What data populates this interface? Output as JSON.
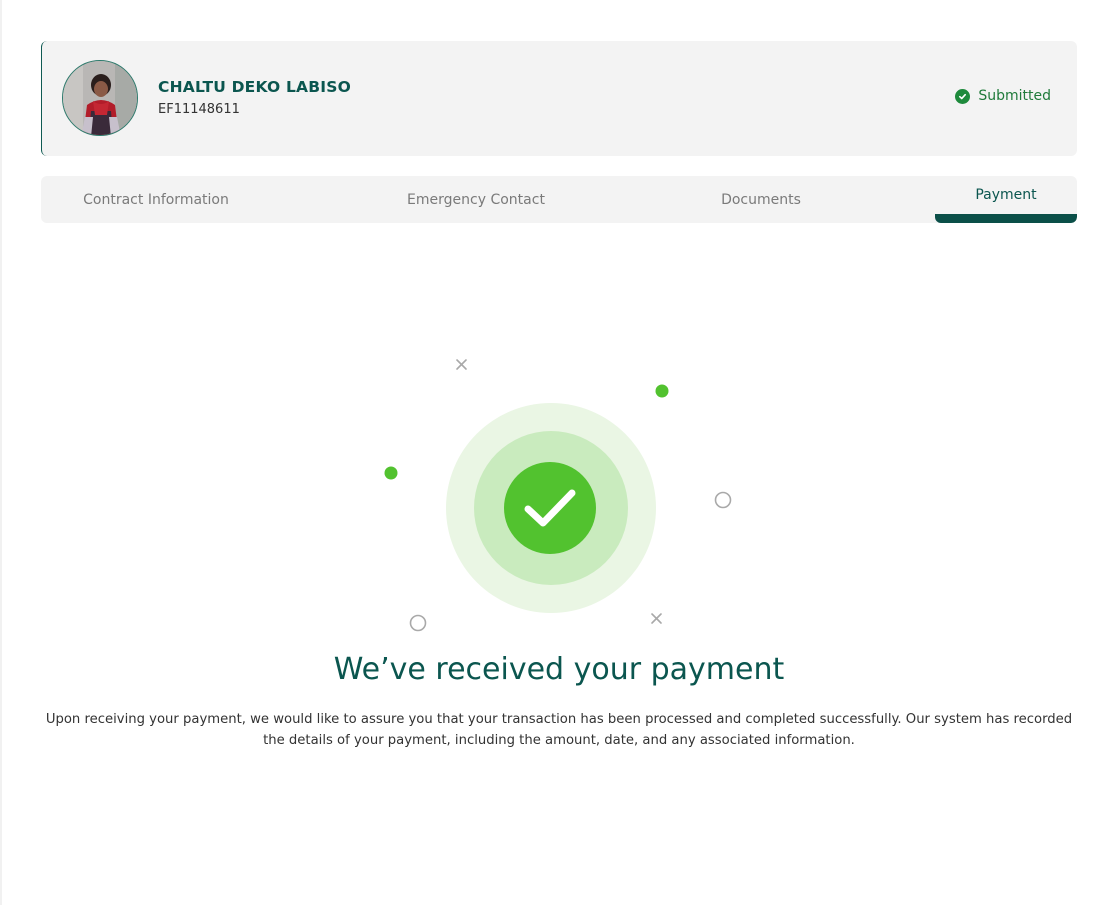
{
  "profile": {
    "name": "CHALTU DEKO LABISO",
    "id": "EF11148611",
    "status": "Submitted",
    "avatar_icon": "user-photo"
  },
  "tabs": [
    {
      "label": "Contract Information",
      "active": false
    },
    {
      "label": "Emergency Contact",
      "active": false
    },
    {
      "label": "Documents",
      "active": false
    },
    {
      "label": "Payment",
      "active": true
    }
  ],
  "confirmation": {
    "icon": "check-circle-icon",
    "title": "We’ve received your payment",
    "message": "Upon receiving your payment, we would like to assure you that your transaction has been processed and completed successfully. Our system has recorded the details of your payment, including the amount, date, and any associated information."
  },
  "colors": {
    "brand": "#0b564f",
    "success": "#52c22f",
    "status_green": "#1f7a3a",
    "panel_bg": "#f3f3f3"
  }
}
